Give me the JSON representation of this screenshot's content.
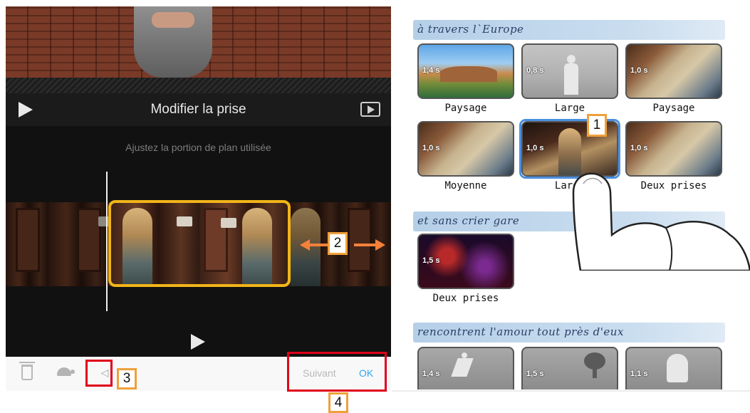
{
  "editor": {
    "title": "Modifier la prise",
    "hint": "Ajustez la portion de plan utilisée",
    "callout_2": "2",
    "callout_3": "3",
    "callout_4": "4",
    "bottom": {
      "next_label": "Suivant",
      "ok_label": "OK"
    },
    "icons": [
      "play-icon",
      "fullscreen-preview-icon",
      "trash-icon",
      "turtle-slow-icon",
      "mute-icon"
    ]
  },
  "browser": {
    "callout_1": "1",
    "sections": [
      {
        "heading": "à travers l`Europe",
        "clips": [
          {
            "duration": "1,4 s",
            "label": "Paysage"
          },
          {
            "duration": "0,8 s",
            "label": "Large"
          },
          {
            "duration": "1,0 s",
            "label": "Paysage"
          },
          {
            "duration": "1,0 s",
            "label": "Moyenne"
          },
          {
            "duration": "1,0 s",
            "label": "Large"
          },
          {
            "duration": "1,0 s",
            "label": "Deux prises"
          }
        ]
      },
      {
        "heading": "et sans crier gare",
        "clips": [
          {
            "duration": "1,5 s",
            "label": "Deux prises"
          }
        ]
      },
      {
        "heading": "rencontrent l'amour tout près d'eux",
        "clips": [
          {
            "duration": "1,4 s",
            "label": ""
          },
          {
            "duration": "1,5 s",
            "label": ""
          },
          {
            "duration": "1,1 s",
            "label": ""
          }
        ]
      }
    ]
  },
  "colors": {
    "selection": "#f2b519",
    "callout_border": "#f0a03a",
    "highlight_box": "#e0001a",
    "ok": "#2ea8f0",
    "selected_clip": "#4a90e2"
  }
}
